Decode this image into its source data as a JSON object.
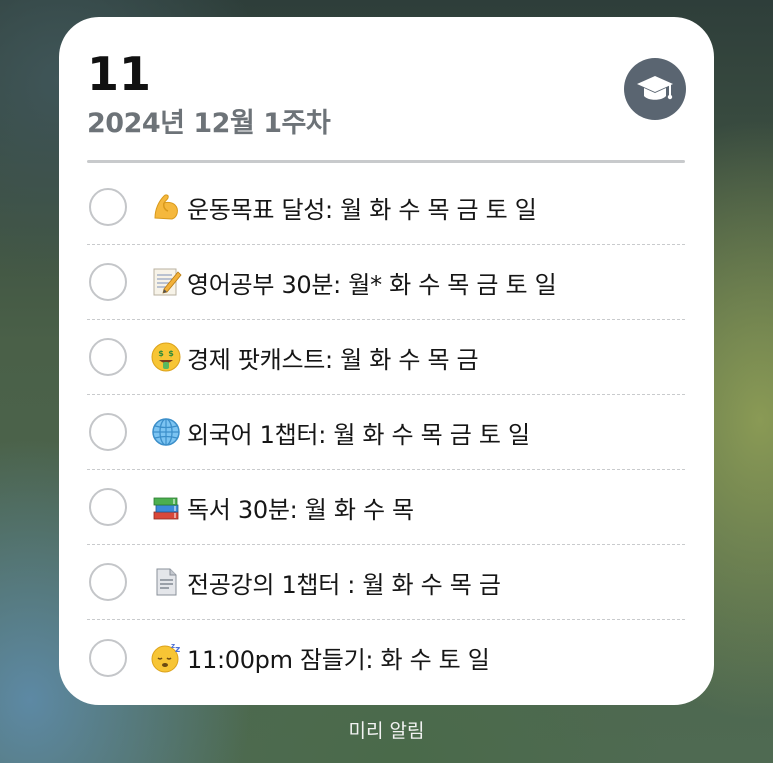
{
  "widget": {
    "day": "11",
    "week_label": "2024년 12월 1주차",
    "badge_icon": "graduation-cap-icon",
    "badge_color": "#5a6571",
    "items": [
      {
        "emoji": "flexed-biceps-icon",
        "label": "운동목표 달성: 월 화 수 목 금 토 일"
      },
      {
        "emoji": "memo-icon",
        "label": "영어공부 30분: 월* 화 수 목 금 토 일"
      },
      {
        "emoji": "money-mouth-face-icon",
        "label": "경제 팟캐스트: 월 화 수 목 금"
      },
      {
        "emoji": "globe-icon",
        "label": "외국어 1챕터: 월 화 수 목 금 토 일"
      },
      {
        "emoji": "books-icon",
        "label": "독서 30분: 월 화 수 목"
      },
      {
        "emoji": "document-icon",
        "label": "전공강의 1챕터 : 월 화 수 목 금"
      },
      {
        "emoji": "sleeping-face-icon",
        "label": "11:00pm 잠들기: 화 수 토 일"
      }
    ]
  },
  "caption": "미리 알림"
}
